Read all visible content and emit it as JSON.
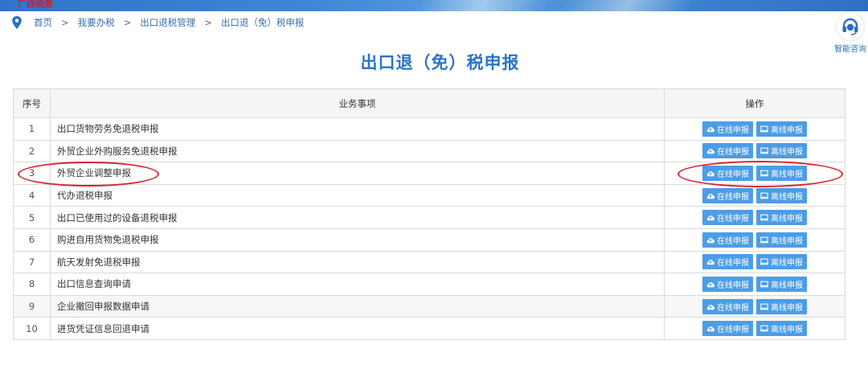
{
  "banner": {
    "logo_text": "广西税务"
  },
  "breadcrumb": {
    "items": [
      "首页",
      "我要办税",
      "出口退税管理",
      "出口退（免）税申报"
    ],
    "separator": ">"
  },
  "help": {
    "label": "智能咨询"
  },
  "page": {
    "title": "出口退（免）税申报"
  },
  "table": {
    "headers": {
      "index": "序号",
      "item": "业务事项",
      "ops": "操作"
    },
    "online_label": "在线申报",
    "offline_label": "离线申报",
    "rows": [
      {
        "index": "1",
        "name": "出口货物劳务免退税申报"
      },
      {
        "index": "2",
        "name": "外贸企业外购服务免退税申报"
      },
      {
        "index": "3",
        "name": "外贸企业调整申报"
      },
      {
        "index": "4",
        "name": "代办退税申报"
      },
      {
        "index": "5",
        "name": "出口已使用过的设备退税申报"
      },
      {
        "index": "6",
        "name": "购进自用货物免退税申报"
      },
      {
        "index": "7",
        "name": "航天发射免退税申报"
      },
      {
        "index": "8",
        "name": "出口信息查询申请"
      },
      {
        "index": "9",
        "name": "企业撤回申报数据申请"
      },
      {
        "index": "10",
        "name": "进货凭证信息回退申请"
      }
    ]
  },
  "colors": {
    "accent": "#2a74c8",
    "button": "#4c9de6",
    "annotation": "#d9232d"
  }
}
